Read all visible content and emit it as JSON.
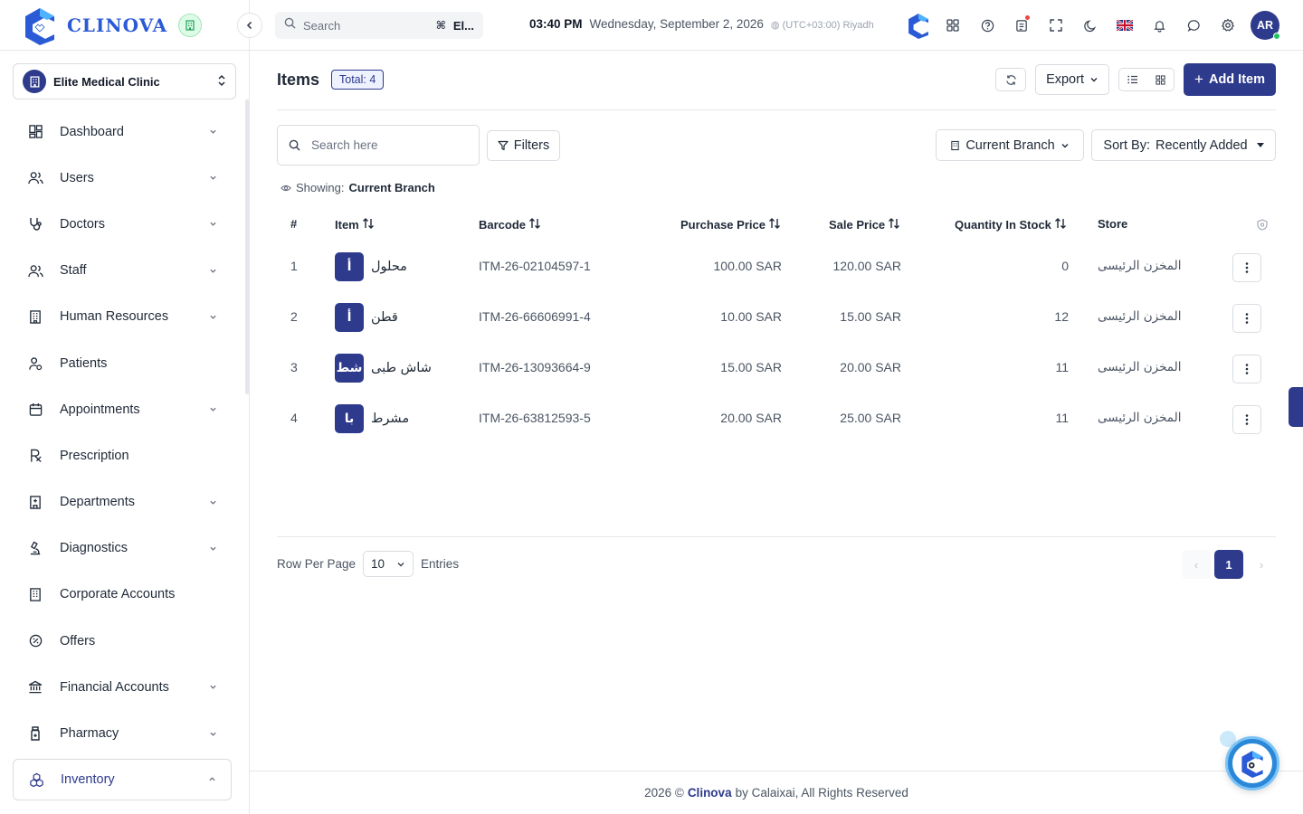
{
  "brand": {
    "name": "CLINOVA"
  },
  "clinic": {
    "name": "Elite Medical Clinic"
  },
  "header": {
    "search_placeholder": "Search",
    "search_shortcut": "⌘",
    "search_scope": "El...",
    "time": "03:40 PM",
    "date": "Wednesday, September 2, 2026",
    "timezone": "(UTC+03:00) Riyadh",
    "avatar_initials": "AR",
    "icons": [
      "apps-grid-icon",
      "help-icon",
      "notes-icon",
      "fullscreen-icon",
      "dark-mode-icon",
      "uk-flag-icon",
      "bell-icon",
      "chat-icon",
      "gear-icon"
    ]
  },
  "sidebar": {
    "items": [
      {
        "label": "Dashboard",
        "icon": "dashboard-icon",
        "has_children": true
      },
      {
        "label": "Users",
        "icon": "users-icon",
        "has_children": true
      },
      {
        "label": "Doctors",
        "icon": "stethoscope-icon",
        "has_children": true
      },
      {
        "label": "Staff",
        "icon": "staff-icon",
        "has_children": true
      },
      {
        "label": "Human Resources",
        "icon": "building-icon",
        "has_children": true
      },
      {
        "label": "Patients",
        "icon": "patient-icon",
        "has_children": false
      },
      {
        "label": "Appointments",
        "icon": "calendar-icon",
        "has_children": true
      },
      {
        "label": "Prescription",
        "icon": "rx-icon",
        "has_children": false
      },
      {
        "label": "Departments",
        "icon": "department-icon",
        "has_children": true
      },
      {
        "label": "Diagnostics",
        "icon": "microscope-icon",
        "has_children": true
      },
      {
        "label": "Corporate Accounts",
        "icon": "corporate-icon",
        "has_children": false
      },
      {
        "label": "Offers",
        "icon": "percent-icon",
        "has_children": false
      },
      {
        "label": "Financial Accounts",
        "icon": "bank-icon",
        "has_children": true
      },
      {
        "label": "Pharmacy",
        "icon": "bottle-icon",
        "has_children": true
      },
      {
        "label": "Inventory",
        "icon": "boxes-icon",
        "has_children": true,
        "active": true
      }
    ]
  },
  "page": {
    "title": "Items",
    "total_label": "Total: 4",
    "export_label": "Export",
    "add_label": "Add Item",
    "search_placeholder": "Search here",
    "filters_label": "Filters",
    "branch_label": "Current Branch",
    "sort_prefix": "Sort By:",
    "sort_value": "Recently Added",
    "showing_prefix": "Showing:",
    "showing_value": "Current Branch"
  },
  "table": {
    "columns": [
      "#",
      "Item",
      "Barcode",
      "Purchase Price",
      "Sale Price",
      "Quantity In Stock",
      "Store"
    ],
    "rows": [
      {
        "index": "1",
        "avatar": "أ",
        "name": "محلول",
        "barcode": "ITM-26-02104597-1",
        "purchase": "100.00 SAR",
        "sale": "120.00 SAR",
        "qty": "0",
        "store": "المخزن الرئيسى"
      },
      {
        "index": "2",
        "avatar": "أ",
        "name": "قطن",
        "barcode": "ITM-26-66606991-4",
        "purchase": "10.00 SAR",
        "sale": "15.00 SAR",
        "qty": "12",
        "store": "المخزن الرئيسى"
      },
      {
        "index": "3",
        "avatar": "شط",
        "name": "شاش طبى",
        "barcode": "ITM-26-13093664-9",
        "purchase": "15.00 SAR",
        "sale": "20.00 SAR",
        "qty": "11",
        "store": "المخزن الرئيسى"
      },
      {
        "index": "4",
        "avatar": "با",
        "name": "مشرط",
        "barcode": "ITM-26-63812593-5",
        "purchase": "20.00 SAR",
        "sale": "25.00 SAR",
        "qty": "11",
        "store": "المخزن الرئيسى"
      }
    ]
  },
  "pagination": {
    "rows_label": "Row Per Page",
    "rows_value": "10",
    "entries_label": "Entries",
    "current_page": "1"
  },
  "footer": {
    "prefix": "2026 ©",
    "brand": "Clinova",
    "suffix": "by Calaixai, All Rights Reserved"
  },
  "colors": {
    "primary": "#2e3a8c",
    "brand_blue": "#2b5ad6",
    "border": "#d9dce1"
  }
}
